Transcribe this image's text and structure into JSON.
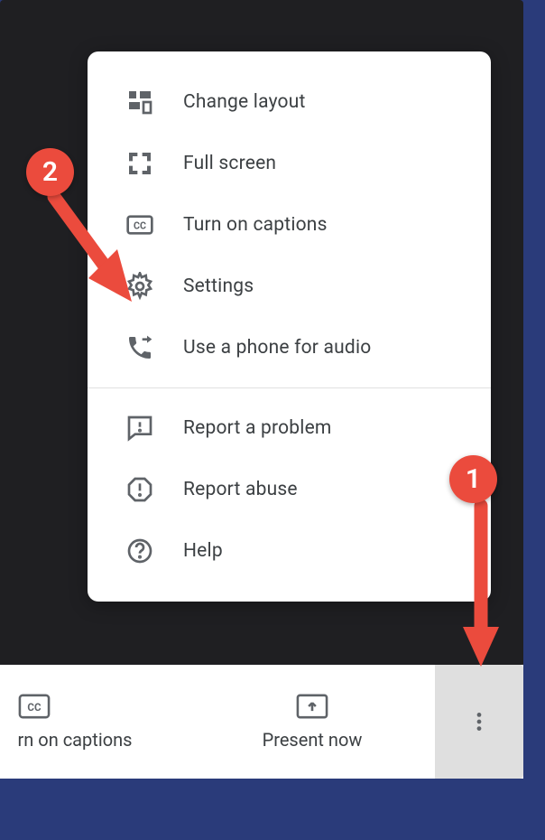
{
  "menu": {
    "items": [
      {
        "label": "Change layout"
      },
      {
        "label": "Full screen"
      },
      {
        "label": "Turn on captions"
      },
      {
        "label": "Settings"
      },
      {
        "label": "Use a phone for audio"
      },
      {
        "label": "Report a problem"
      },
      {
        "label": "Report abuse"
      },
      {
        "label": "Help"
      }
    ]
  },
  "bottomBar": {
    "captions": "rn on captions",
    "present": "Present now"
  },
  "annotations": {
    "badge1": "1",
    "badge2": "2"
  }
}
